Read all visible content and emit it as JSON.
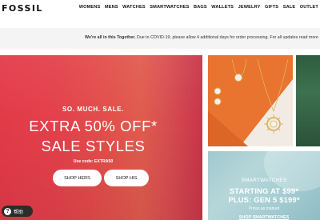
{
  "header": {
    "logo": "FOSSIL",
    "nav": [
      "WOMENS",
      "MENS",
      "WATCHES",
      "SMARTWATCHES",
      "BAGS",
      "WALLETS",
      "JEWELRY",
      "GIFTS",
      "SALE",
      "OUTLET"
    ]
  },
  "notice": {
    "bold": "We're all in this Together.",
    "text": " Due to COVID-19, please allow 4 additional days for order processing. For all updates read more"
  },
  "hero": {
    "kicker": "SO. MUCH. SALE.",
    "headline_line1": "EXTRA 50% OFF*",
    "headline_line2": "SALE STYLES",
    "code": "Use code: EXTRA50",
    "button_hers": "SHOP HERS",
    "button_his": "SHOP HIS"
  },
  "help": {
    "icon": "?",
    "label": "帮助"
  },
  "smartwatches": {
    "title": "SMARTWATCHES",
    "line1": "STARTING AT $99*",
    "line2": "PLUS: GEN 5 $199*",
    "note": "Prices as marked",
    "cta": "SHOP SMARTWATCHES"
  },
  "colors": {
    "hero_red": "#e23a48",
    "jewelry_orange": "#e8702e",
    "green_tile": "#2f5c3f",
    "smart_teal": "#9fc9cf",
    "help_bg": "#2c2c2c"
  },
  "icons": {
    "help": "question-circle-icon"
  }
}
